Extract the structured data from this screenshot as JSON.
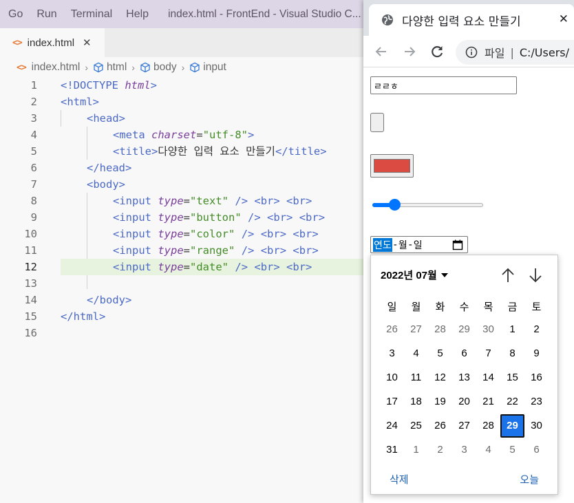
{
  "vscode": {
    "menu": [
      "Go",
      "Run",
      "Terminal",
      "Help"
    ],
    "window_title": "index.html - FrontEnd - Visual Studio C...",
    "tab": {
      "label": "index.html",
      "close": "✕",
      "icon": "<>"
    },
    "breadcrumb": {
      "file": "index.html",
      "items": [
        "html",
        "body",
        "input"
      ]
    },
    "line_numbers": [
      "1",
      "2",
      "3",
      "4",
      "5",
      "6",
      "7",
      "8",
      "9",
      "10",
      "11",
      "12",
      "13",
      "14",
      "15",
      "16"
    ],
    "active_line": "12",
    "code": {
      "l1_open": "<!",
      "l1_doctype": "DOCTYPE",
      "l1_html": "html",
      "l1_close": ">",
      "l2": "<html>",
      "l3": "<head>",
      "l4_open": "<meta",
      "l4_attr": "charset",
      "l4_eq": "=",
      "l4_val": "\"utf-8\"",
      "l4_close": ">",
      "l5_open": "<title>",
      "l5_text": "다양한 입력 요소 만들기",
      "l5_close": "</title>",
      "l6": "</head>",
      "l7": "<body>",
      "input_tag": "<input",
      "type_attr": "type",
      "eq": "=",
      "slash_close": "/>",
      "br": "<br>",
      "l8_val": "\"text\"",
      "l9_val": "\"button\"",
      "l10_val": "\"color\"",
      "l11_val": "\"range\"",
      "l12_val": "\"date\"",
      "l14": "</body>",
      "l15": "</html>"
    }
  },
  "browser": {
    "tab_title": "다양한 입력 요소 만들기",
    "tab_close": "✕",
    "omnibox": {
      "label": "파일",
      "separator": "|",
      "url": "C:/Users/"
    },
    "page": {
      "text_value": "ㄹㄹㅎ",
      "color_value": "#db4b42",
      "range_value": 0.2,
      "date_input": {
        "year": "연도",
        "month": "월",
        "day": "일",
        "dash": "-"
      },
      "picker": {
        "month_label": "2022년 07월",
        "weekdays": [
          "일",
          "월",
          "화",
          "수",
          "목",
          "금",
          "토"
        ],
        "days": [
          [
            "26",
            "27",
            "28",
            "29",
            "30",
            "1",
            "2"
          ],
          [
            "3",
            "4",
            "5",
            "6",
            "7",
            "8",
            "9"
          ],
          [
            "10",
            "11",
            "12",
            "13",
            "14",
            "15",
            "16"
          ],
          [
            "17",
            "18",
            "19",
            "20",
            "21",
            "22",
            "23"
          ],
          [
            "24",
            "25",
            "26",
            "27",
            "28",
            "29",
            "30"
          ],
          [
            "31",
            "1",
            "2",
            "3",
            "4",
            "5",
            "6"
          ]
        ],
        "other_month": [
          [
            true,
            true,
            true,
            true,
            true,
            false,
            false
          ],
          [
            false,
            false,
            false,
            false,
            false,
            false,
            false
          ],
          [
            false,
            false,
            false,
            false,
            false,
            false,
            false
          ],
          [
            false,
            false,
            false,
            false,
            false,
            false,
            false
          ],
          [
            false,
            false,
            false,
            false,
            false,
            false,
            false
          ],
          [
            false,
            true,
            true,
            true,
            true,
            true,
            true
          ]
        ],
        "selected_day": "29",
        "delete_label": "삭제",
        "today_label": "오늘"
      }
    }
  }
}
